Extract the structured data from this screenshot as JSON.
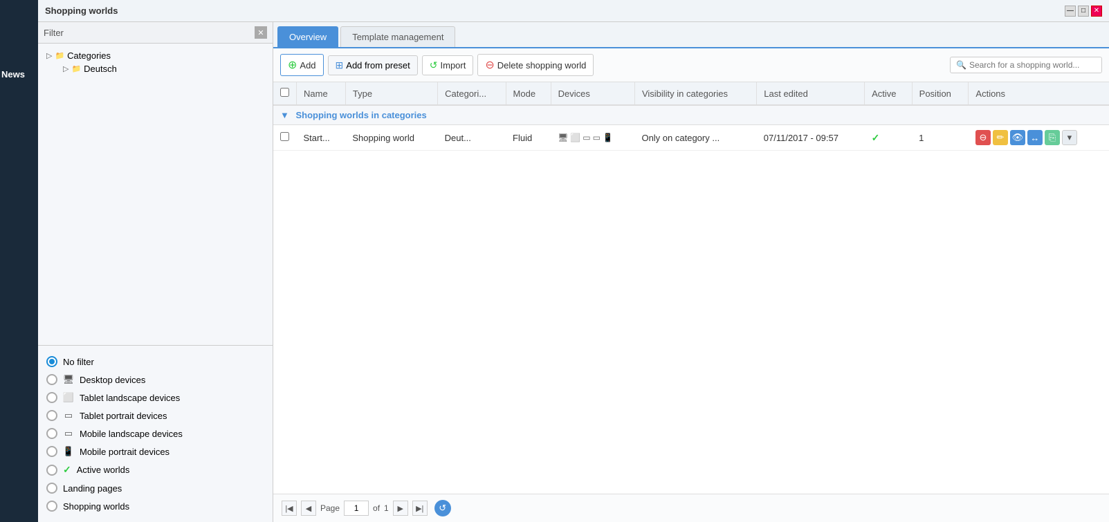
{
  "title_bar": {
    "title": "Shopping worlds",
    "btn_minimize": "—",
    "btn_maximize": "□",
    "btn_close": "✕"
  },
  "left_panel": {
    "filter_label": "Filter",
    "tree": {
      "root_label": "Categories",
      "child_label": "Deutsch"
    },
    "filter_options": [
      {
        "id": "no_filter",
        "label": "No filter",
        "selected": true,
        "icon": null
      },
      {
        "id": "desktop",
        "label": "Desktop devices",
        "selected": false,
        "icon": "desktop"
      },
      {
        "id": "tablet_landscape",
        "label": "Tablet landscape devices",
        "selected": false,
        "icon": "tablet_landscape"
      },
      {
        "id": "tablet_portrait",
        "label": "Tablet portrait devices",
        "selected": false,
        "icon": "tablet_portrait"
      },
      {
        "id": "mobile_landscape",
        "label": "Mobile landscape devices",
        "selected": false,
        "icon": "mobile_landscape"
      },
      {
        "id": "mobile_portrait",
        "label": "Mobile portrait devices",
        "selected": false,
        "icon": "mobile_portrait"
      },
      {
        "id": "active_worlds",
        "label": "Active worlds",
        "selected": false,
        "icon": "checkmark"
      },
      {
        "id": "landing_pages",
        "label": "Landing pages",
        "selected": false,
        "icon": null
      },
      {
        "id": "shopping_worlds",
        "label": "Shopping worlds",
        "selected": false,
        "icon": null
      }
    ]
  },
  "tabs": [
    {
      "id": "overview",
      "label": "Overview",
      "active": true
    },
    {
      "id": "template_management",
      "label": "Template management",
      "active": false
    }
  ],
  "toolbar": {
    "add_label": "Add",
    "add_from_preset_label": "Add from preset",
    "import_label": "Import",
    "delete_label": "Delete shopping world",
    "search_placeholder": "Search for a shopping world..."
  },
  "table": {
    "columns": [
      {
        "id": "checkbox",
        "label": ""
      },
      {
        "id": "name",
        "label": "Name"
      },
      {
        "id": "type",
        "label": "Type"
      },
      {
        "id": "category",
        "label": "Categori..."
      },
      {
        "id": "mode",
        "label": "Mode"
      },
      {
        "id": "devices",
        "label": "Devices"
      },
      {
        "id": "visibility",
        "label": "Visibility in categories"
      },
      {
        "id": "last_edited",
        "label": "Last edited"
      },
      {
        "id": "active",
        "label": "Active"
      },
      {
        "id": "position",
        "label": "Position"
      },
      {
        "id": "actions",
        "label": "Actions"
      }
    ],
    "section_header": "Shopping worlds in categories",
    "rows": [
      {
        "name": "Start...",
        "type": "Shopping world",
        "category": "Deut...",
        "mode": "Fluid",
        "devices": [
          "desktop",
          "tablet_landscape",
          "tablet_portrait",
          "mobile_landscape",
          "mobile_portrait"
        ],
        "visibility": "Only on category ...",
        "last_edited": "07/11/2017 - 09:57",
        "active": true,
        "position": "1"
      }
    ]
  },
  "pagination": {
    "page_label": "Page",
    "current_page": "1",
    "of_label": "of",
    "total_pages": "1"
  },
  "news_label": "News"
}
